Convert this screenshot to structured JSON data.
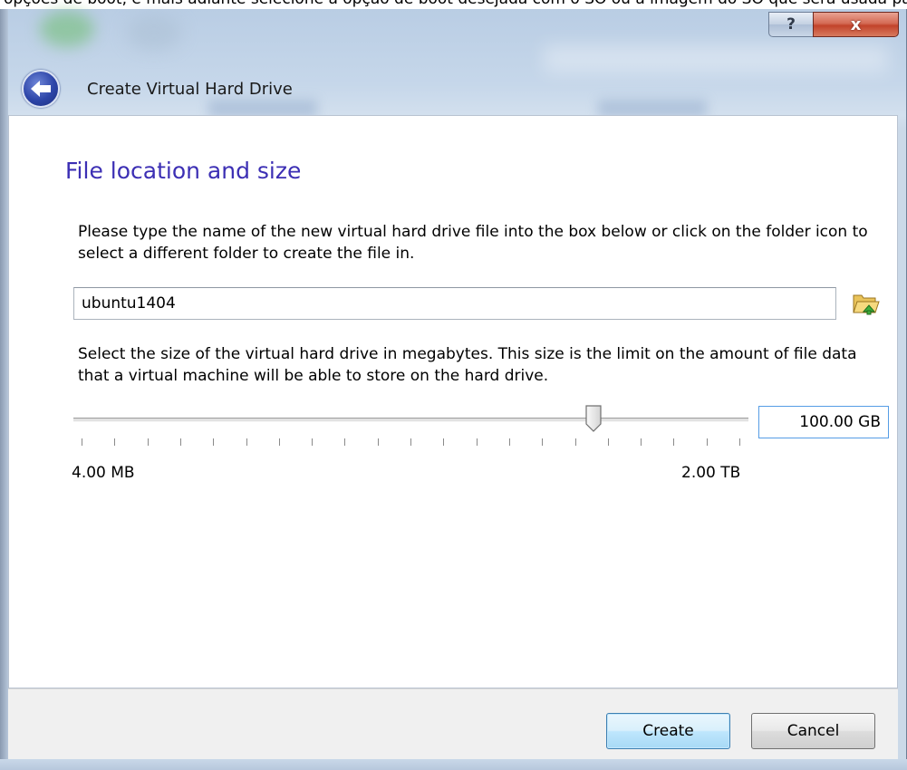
{
  "background_text": "opções de boot, e mais adiante selecione a opção de boot desejada com o SO ou a imagem do SO que será usada para executá-lo",
  "window": {
    "title": "Create Virtual Hard Drive",
    "help_glyph": "?",
    "close_glyph": "x"
  },
  "page": {
    "heading": "File location and size",
    "location_description": "Please type the name of the new virtual hard drive file into the box below or click on the folder icon to select a different folder to create the file in.",
    "file_name": "ubuntu1404",
    "size_description": "Select the size of the virtual hard drive in megabytes. This size is the limit on the amount of file data that a virtual machine will be able to store on the hard drive.",
    "size_value": "100.00 GB",
    "slider": {
      "min_label": "4.00 MB",
      "max_label": "2.00 TB",
      "position_fraction": 0.77,
      "tick_count": 21
    }
  },
  "footer": {
    "create_label": "Create",
    "cancel_label": "Cancel"
  },
  "icons": {
    "back": "back-arrow-icon",
    "folder": "folder-open-icon",
    "help": "help-icon",
    "close": "close-icon"
  },
  "colors": {
    "heading": "#3c2fb4",
    "close_button": "#c2432b",
    "focus_border": "#569de5"
  }
}
